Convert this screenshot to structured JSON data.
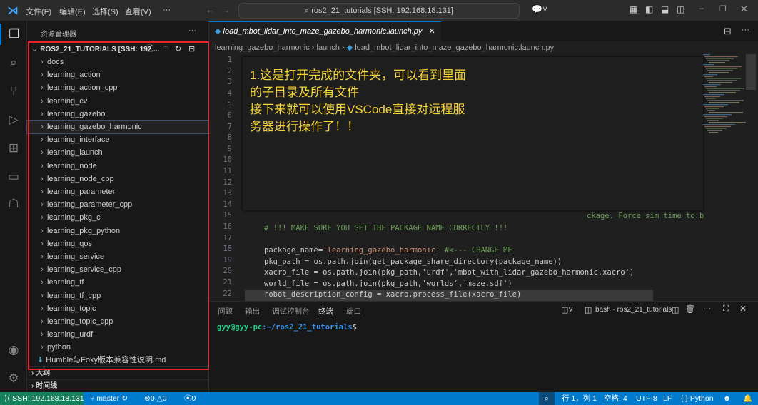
{
  "titlebar": {
    "menus": [
      "文件(F)",
      "编辑(E)",
      "选择(S)",
      "查看(V)",
      "···"
    ],
    "search": "ros2_21_tutorials [SSH: 192.168.18.131]"
  },
  "sidebar": {
    "title": "资源管理器",
    "more": "···",
    "root": "ROS2_21_TUTORIALS [SSH: 192....",
    "items": [
      "docs",
      "learning_action",
      "learning_action_cpp",
      "learning_cv",
      "learning_gazebo",
      "learning_gazebo_harmonic",
      "learning_interface",
      "learning_launch",
      "learning_node",
      "learning_node_cpp",
      "learning_parameter",
      "learning_parameter_cpp",
      "learning_pkg_c",
      "learning_pkg_python",
      "learning_qos",
      "learning_service",
      "learning_service_cpp",
      "learning_tf",
      "learning_tf_cpp",
      "learning_topic",
      "learning_topic_cpp",
      "learning_urdf",
      "python"
    ],
    "selected": "learning_gazebo_harmonic",
    "file": "Humble与Foxy版本兼容性说明.md",
    "outline": "大纲",
    "timeline": "时间线"
  },
  "editor": {
    "tab": "load_mbot_lidar_into_maze_gazebo_harmonic.launch.py",
    "breadcrumb": [
      "learning_gazebo_harmonic",
      "launch",
      "load_mbot_lidar_into_maze_gazebo_harmonic.launch.py"
    ],
    "line15": "ckage. Force sim time to b",
    "line16": "# !!! MAKE SURE YOU SET THE PACKAGE NAME CORRECTLY !!!",
    "line18a": "package_name=",
    "line18b": "'learning_gazebo_harmonic'",
    "line18c": " #<--- CHANGE ME",
    "line19": "pkg_path = os.path.join(get_package_share_directory(package_name))",
    "line20": "xacro_file = os.path.join(pkg_path,'urdf','mbot_with_lidar_gazebo_harmonic.xacro')",
    "line21": "world_file = os.path.join(pkg_path,'worlds','maze.sdf')",
    "line22": "robot_description_config = xacro.process_file(xacro_file)",
    "annotation": [
      "1.这是打开完成的文件夹，可以看到里面",
      "的子目录及所有文件",
      "接下来就可以使用VSCode直接对远程服",
      "务器进行操作了！！"
    ]
  },
  "panel": {
    "tabs": [
      "问题",
      "输出",
      "调试控制台",
      "终端",
      "端口"
    ],
    "active": "终端",
    "terminal_name": "bash - ros2_21_tutorials",
    "prompt_user": "gyy@gyy-pc",
    "prompt_path": ":~/ros2_21_tutorials",
    "prompt_end": "$"
  },
  "status": {
    "remote": "SSH: 192.168.18.131",
    "branch": "master",
    "errors": "0",
    "warnings": "0",
    "ports": "0",
    "position": "行 1，列 1",
    "spaces": "空格: 4",
    "encoding": "UTF-8",
    "eol": "LF",
    "language": "Python"
  },
  "colors": {
    "status_bar": "#007acc",
    "remote": "#16825d",
    "annotation": "#f3d23c",
    "highlight_box": "#e8262a"
  }
}
